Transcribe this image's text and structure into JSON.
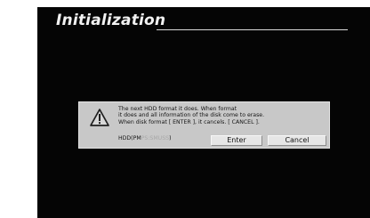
{
  "screen": {
    "title": "Initialization"
  },
  "dialog": {
    "message_lines": [
      "The next HDD format it does. When format",
      "it does and all information of the disk come to erase.",
      "When disk format [ ENTER ], it cancels. [ CANCEL ]."
    ],
    "hdd_prefix": "HDD(PM",
    "hdd_status": "PS:SMUSS",
    "hdd_suffix": ")",
    "enter_label": "Enter",
    "cancel_label": "Cancel",
    "icon": "warning-triangle-icon"
  },
  "colors": {
    "screen_background": "#050505",
    "dialog_background": "#c8c8c8",
    "button_background": "#e6e6e6",
    "text": "#151515",
    "title_text": "#f2f2f2"
  }
}
